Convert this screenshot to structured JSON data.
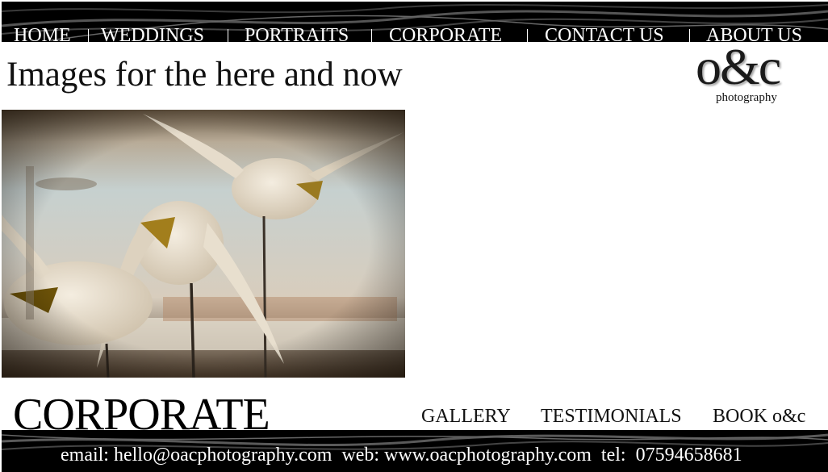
{
  "nav": {
    "items": [
      {
        "label": "HOME"
      },
      {
        "label": "WEDDINGS"
      },
      {
        "label": "PORTRAITS"
      },
      {
        "label": "CORPORATE"
      },
      {
        "label": "CONTACT US"
      },
      {
        "label": "ABOUT US"
      }
    ]
  },
  "header": {
    "tagline": "Images for the here and now",
    "logo_main": "o&c",
    "logo_sub": "photography"
  },
  "photo": {
    "subject": "carved wooden seagull figurines"
  },
  "section": {
    "title": "CORPORATE",
    "links": [
      {
        "label": "GALLERY"
      },
      {
        "label": "TESTIMONIALS"
      },
      {
        "label": "BOOK o&c"
      }
    ]
  },
  "footer": {
    "contact": "email: hello@oacphotography.com  web: www.oacphotography.com  tel:  07594658681"
  },
  "colors": {
    "banner": "#000000",
    "banner_text": "#ffffff",
    "page_background": "#ffffff"
  }
}
